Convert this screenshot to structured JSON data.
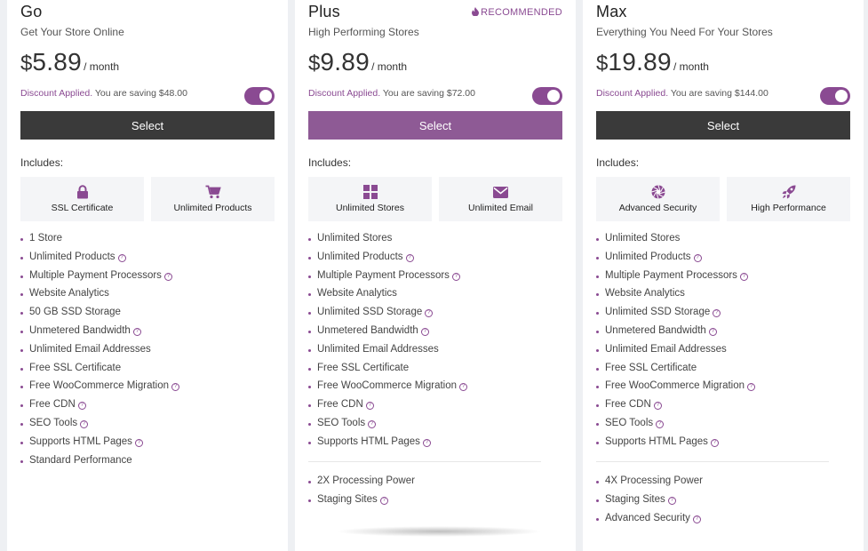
{
  "colors": {
    "accent": "#8a4a92",
    "dark_button": "#3a3a3a",
    "page_bg": "#eef0f3"
  },
  "plans": [
    {
      "name": "Go",
      "tagline": "Get Your Store Online",
      "currency": "$",
      "price": "5.89",
      "period": "/ month",
      "discount_label": "Discount Applied.",
      "discount_text": "You are saving $48.00",
      "select_label": "Select",
      "includes_label": "Includes:",
      "features": [
        {
          "icon": "lock-icon",
          "label": "SSL Certificate"
        },
        {
          "icon": "cart-icon",
          "label": "Unlimited Products"
        }
      ],
      "items": [
        "1 Store",
        "Unlimited Products",
        "Multiple Payment Processors",
        "Website Analytics",
        "50 GB SSD Storage",
        "Unmetered Bandwidth",
        "Unlimited Email Addresses",
        "Free SSL Certificate",
        "Free WooCommerce Migration",
        "Free CDN",
        "SEO Tools",
        "Supports HTML Pages",
        "Standard Performance"
      ],
      "extra_items": []
    },
    {
      "name": "Plus",
      "badge": "RECOMMENDED",
      "tagline": "High Performing Stores",
      "currency": "$",
      "price": "9.89",
      "period": "/ month",
      "discount_label": "Discount Applied.",
      "discount_text": "You are saving $72.00",
      "select_label": "Select",
      "includes_label": "Includes:",
      "features": [
        {
          "icon": "grid-icon",
          "label": "Unlimited Stores"
        },
        {
          "icon": "envelope-icon",
          "label": "Unlimited Email"
        }
      ],
      "items": [
        "Unlimited Stores",
        "Unlimited Products",
        "Multiple Payment Processors",
        "Website Analytics",
        "Unlimited SSD Storage",
        "Unmetered Bandwidth",
        "Unlimited Email Addresses",
        "Free SSL Certificate",
        "Free WooCommerce Migration",
        "Free CDN",
        "SEO Tools",
        "Supports HTML Pages"
      ],
      "extra_items": [
        "2X Processing Power",
        "Staging Sites"
      ]
    },
    {
      "name": "Max",
      "tagline": "Everything You Need For Your Stores",
      "currency": "$",
      "price": "19.89",
      "period": "/ month",
      "discount_label": "Discount Applied.",
      "discount_text": "You are saving $144.00",
      "select_label": "Select",
      "includes_label": "Includes:",
      "features": [
        {
          "icon": "shutter-icon",
          "label": "Advanced Security"
        },
        {
          "icon": "rocket-icon",
          "label": "High Performance"
        }
      ],
      "items": [
        "Unlimited Stores",
        "Unlimited Products",
        "Multiple Payment Processors",
        "Website Analytics",
        "Unlimited SSD Storage",
        "Unmetered Bandwidth",
        "Unlimited Email Addresses",
        "Free SSL Certificate",
        "Free WooCommerce Migration",
        "Free CDN",
        "SEO Tools",
        "Supports HTML Pages"
      ],
      "extra_items": [
        "4X Processing Power",
        "Staging Sites",
        "Advanced Security"
      ]
    }
  ],
  "help_items": [
    "Unlimited Products",
    "Multiple Payment Processors",
    "Unmetered Bandwidth",
    "Free WooCommerce Migration",
    "Free CDN",
    "SEO Tools",
    "Supports HTML Pages",
    "Unlimited SSD Storage",
    "Staging Sites",
    "Advanced Security"
  ],
  "help_glyph": "?"
}
